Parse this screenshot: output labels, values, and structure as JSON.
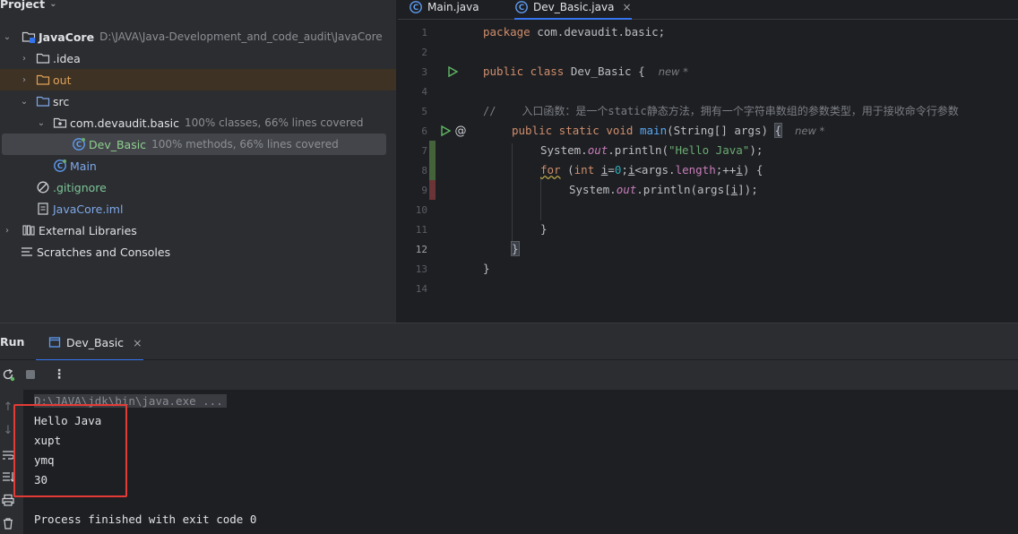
{
  "project": {
    "title": "Project",
    "tree": [
      {
        "label": "JavaCore",
        "hint": "D:\\JAVA\\Java-Development_and_code_audit\\JavaCore",
        "icon": "module-folder-icon"
      },
      {
        "label": ".idea",
        "icon": "folder-icon"
      },
      {
        "label": "out",
        "icon": "excluded-folder-icon"
      },
      {
        "label": "src",
        "icon": "source-folder-icon"
      },
      {
        "label": "com.devaudit.basic",
        "hint": "100% classes, 66% lines covered",
        "icon": "package-icon"
      },
      {
        "label": "Dev_Basic",
        "hint": "100% methods, 66% lines covered",
        "icon": "java-class-icon"
      },
      {
        "label": "Main",
        "icon": "java-class-icon"
      },
      {
        "label": ".gitignore",
        "icon": "gitignore-icon"
      },
      {
        "label": "JavaCore.iml",
        "icon": "iml-file-icon"
      },
      {
        "label": "External Libraries",
        "icon": "libraries-icon"
      },
      {
        "label": "Scratches and Consoles",
        "icon": "scratches-icon"
      }
    ]
  },
  "editor": {
    "tabs": [
      {
        "label": "Main.java",
        "active": false
      },
      {
        "label": "Dev_Basic.java",
        "active": true,
        "close": "×"
      }
    ],
    "line_numbers": [
      "1",
      "2",
      "3",
      "4",
      "5",
      "6",
      "7",
      "8",
      "9",
      "10",
      "11",
      "12",
      "13",
      "14"
    ],
    "current_line": "12",
    "code": {
      "l1_kw": "package",
      "l1_rest": " com.devaudit.basic;",
      "l3_kw": "public class",
      "l3_rest": " Dev_Basic {",
      "l3_hint": "new *",
      "l5_comment": "//    入口函数：是一个static静态方法，拥有一个字符串数组的参数类型，用于接收命令行参数",
      "l6_kw": "public static void",
      "l6_fn": "main",
      "l6_rest": "(String[] args) ",
      "l6_brace": "{",
      "l6_hint": "new *",
      "l7_a": "System.",
      "l7_out": "out",
      "l7_b": ".println(",
      "l7_str": "\"Hello Java\"",
      "l7_c": ");",
      "l8_for": "for",
      "l8_a": " (",
      "l8_int": "int",
      "l8_i1": "i",
      "l8_eq": "=",
      "l8_zero": "0",
      "l8_semi": ";",
      "l8_i2": "i",
      "l8_lt": "<args.",
      "l8_length": "length",
      "l8_inc": ";++",
      "l8_i3": "i",
      "l8_end": ") {",
      "l9_a": "System.",
      "l9_out": "out",
      "l9_b": ".println(args[",
      "l9_i": "i",
      "l9_c": "]);",
      "l11": "}",
      "l12": "}",
      "l13": "}"
    }
  },
  "run": {
    "title": "Run",
    "tab_label": "Dev_Basic",
    "close": "×",
    "command": "D:\\JAVA\\jdk\\bin\\java.exe ...",
    "output": [
      "Hello Java",
      "xupt",
      "ymq",
      "30"
    ],
    "finish": "Process finished with exit code 0"
  },
  "colors": {
    "highlight_box": "#e43b37",
    "accent": "#3574f0"
  }
}
